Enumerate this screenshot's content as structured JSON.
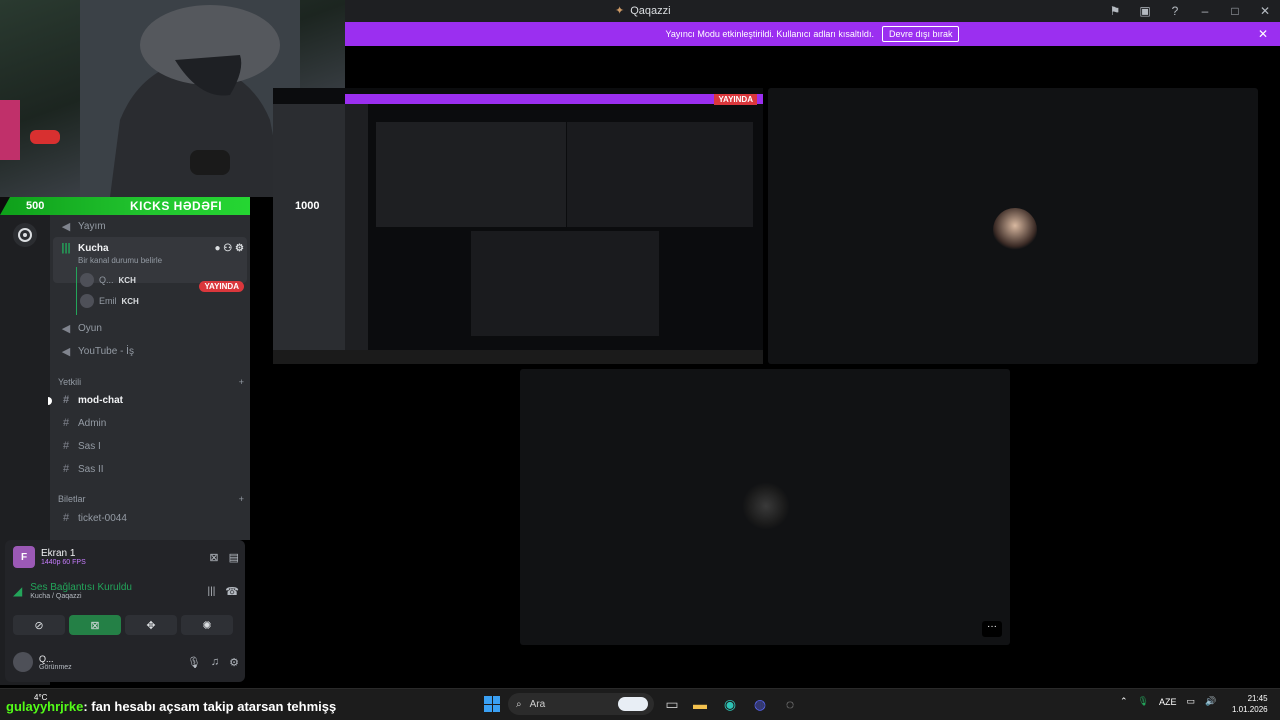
{
  "titlebar": {
    "title": "Qaqazzi",
    "icons": [
      "flag-icon",
      "inbox-icon",
      "help-icon",
      "minimize-icon",
      "maximize-icon",
      "close-icon"
    ]
  },
  "banner": {
    "message": "Yayıncı Modu etkinleştirildi. Kullanıcı adları kısaltıldı.",
    "button": "Devre dışı bırak"
  },
  "overlay": {
    "kicks_number": "500",
    "kicks_label": "KICKS HƏDƏFI"
  },
  "channels": {
    "items": [
      {
        "label": "Yayım"
      },
      {
        "label": "Kucha",
        "status": "Bir kanal durumu belirle"
      },
      {
        "label": "Oyun"
      },
      {
        "label": "YouTube - İş"
      }
    ],
    "voice_users": [
      {
        "name": "Q...",
        "tag": "KCH",
        "live": "YAYINDA"
      },
      {
        "name": "Emil",
        "tag": "KCH"
      }
    ],
    "categories": [
      {
        "label": "Yetkili",
        "items": [
          "mod-chat",
          "Admin",
          "Sas I",
          "Sas II"
        ]
      },
      {
        "label": "Biletlar",
        "items": [
          "ticket-0044"
        ]
      }
    ]
  },
  "panel": {
    "screen_title": "Ekran 1",
    "screen_quality": "1440p 60 FPS",
    "screen_avatar_letter": "F",
    "voice_status": "Ses Bağlantısı Kuruldu",
    "voice_channel": "Kucha / Qaqazzi",
    "user_name": "Q...",
    "user_status": "Görünmez"
  },
  "tiles": {
    "more_label": "···"
  },
  "nested": {
    "live": "YAYINDA",
    "number": "1000"
  },
  "chat": {
    "user": "gulayyhrjrke",
    "message": ": fan hesabı açsam takip atarsan tehmişş"
  },
  "taskbar": {
    "weather": "4°C",
    "search_placeholder": "Ara",
    "language": "AZE",
    "time": "21:45",
    "date": "1.01.2026"
  },
  "colors": {
    "accent": "#9b2ff0",
    "live": "#da373c",
    "voice_green": "#23a55a",
    "kick_green": "#53fc18"
  }
}
